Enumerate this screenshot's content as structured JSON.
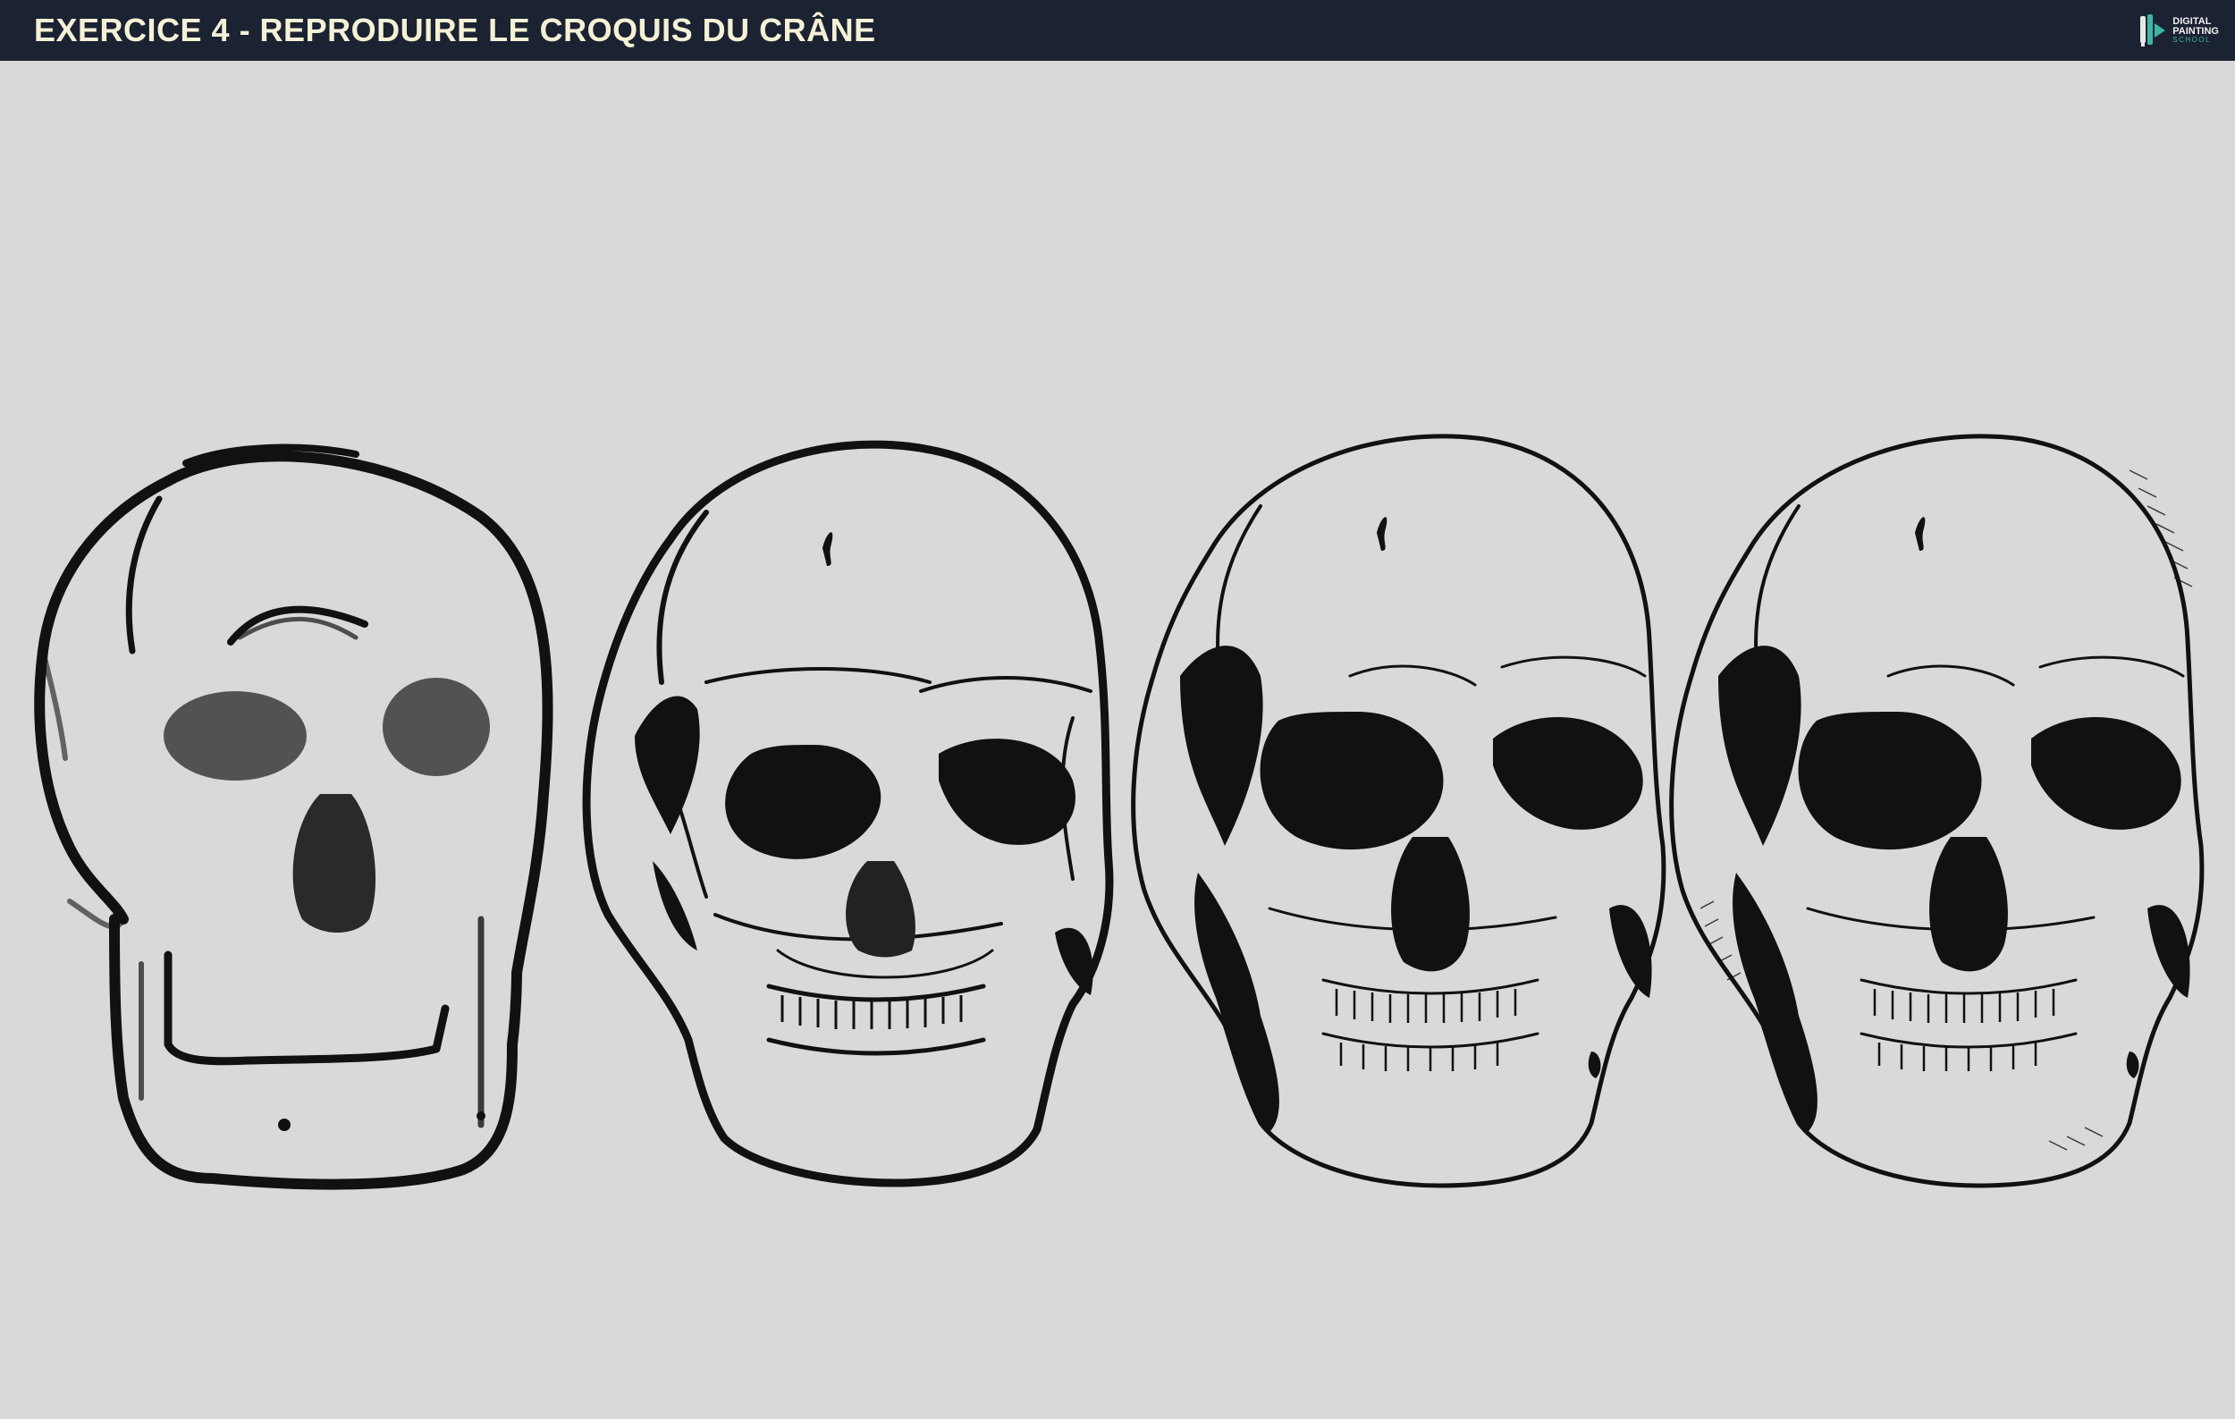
{
  "header": {
    "title": "EXERCICE 4 - REPRODUIRE LE CROQUIS DU CRÂNE",
    "logo": {
      "line1": "DIGITAL",
      "line2": "PAINTING",
      "line3": "SCHOOL",
      "icon": "brush-pen-logo-icon"
    }
  },
  "colors": {
    "header_bg": "#1b2232",
    "title_text": "#f4f1d6",
    "canvas_bg": "#d9d9d9",
    "ink": "#111111",
    "logo_accent": "#3fb5a5"
  },
  "artwork": {
    "skulls": [
      {
        "stage": "rough-sketch",
        "icon": "skull-rough-sketch-icon"
      },
      {
        "stage": "line-refinement",
        "icon": "skull-line-drawing-icon"
      },
      {
        "stage": "ink-shadows",
        "icon": "skull-inked-icon"
      },
      {
        "stage": "final-hatching",
        "icon": "skull-final-icon"
      }
    ]
  }
}
